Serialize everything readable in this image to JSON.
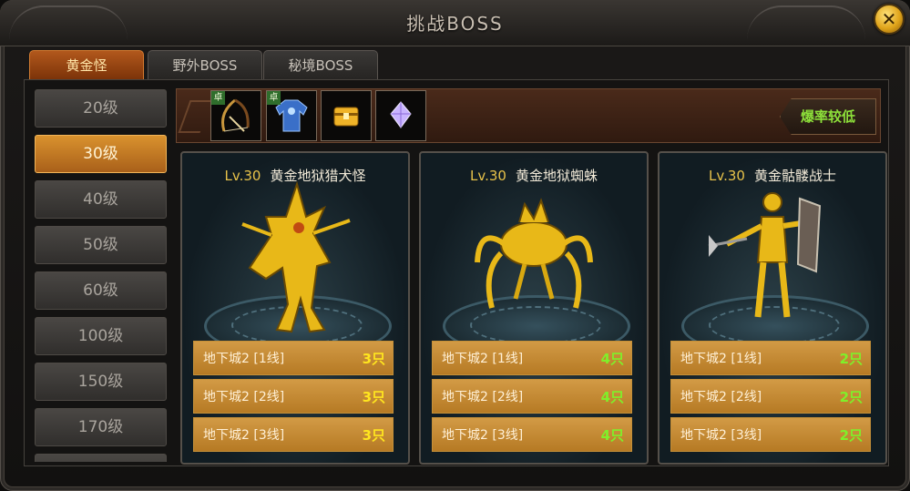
{
  "window": {
    "title": "挑战BOSS",
    "close_icon": "close-icon"
  },
  "tabs": [
    {
      "label": "黄金怪",
      "active": true
    },
    {
      "label": "野外BOSS",
      "active": false
    },
    {
      "label": "秘境BOSS",
      "active": false
    }
  ],
  "levels": [
    {
      "label": "20级",
      "active": false
    },
    {
      "label": "30级",
      "active": true
    },
    {
      "label": "40级",
      "active": false
    },
    {
      "label": "50级",
      "active": false
    },
    {
      "label": "60级",
      "active": false
    },
    {
      "label": "100级",
      "active": false
    },
    {
      "label": "150级",
      "active": false
    },
    {
      "label": "170级",
      "active": false
    }
  ],
  "drops": {
    "items": [
      {
        "icon": "crossbow-icon",
        "badge": "卓"
      },
      {
        "icon": "blue-armor-icon",
        "badge": "卓"
      },
      {
        "icon": "treasure-chest-icon",
        "badge": ""
      },
      {
        "icon": "purple-gem-icon",
        "badge": ""
      }
    ],
    "rate_label": "爆率较低"
  },
  "monsters": [
    {
      "level": "Lv.30",
      "name": "黄金地狱猎犬怪",
      "icon": "hellhound-monster-icon",
      "routes": [
        {
          "location": "地下城2 [1线]",
          "count": "3只"
        },
        {
          "location": "地下城2 [2线]",
          "count": "3只"
        },
        {
          "location": "地下城2 [3线]",
          "count": "3只"
        }
      ]
    },
    {
      "level": "Lv.30",
      "name": "黄金地狱蜘蛛",
      "icon": "spider-monster-icon",
      "routes": [
        {
          "location": "地下城2 [1线]",
          "count": "4只"
        },
        {
          "location": "地下城2 [2线]",
          "count": "4只"
        },
        {
          "location": "地下城2 [3线]",
          "count": "4只"
        }
      ]
    },
    {
      "level": "Lv.30",
      "name": "黄金骷髅战士",
      "icon": "skeleton-warrior-icon",
      "routes": [
        {
          "location": "地下城2 [1线]",
          "count": "2只"
        },
        {
          "location": "地下城2 [2线]",
          "count": "2只"
        },
        {
          "location": "地下城2 [3线]",
          "count": "2只"
        }
      ]
    }
  ],
  "colors": {
    "accent_orange": "#b2581c",
    "count_yellow": "#ffe51f",
    "count_green": "#7ff02a",
    "level_gold": "#e7c24a"
  }
}
